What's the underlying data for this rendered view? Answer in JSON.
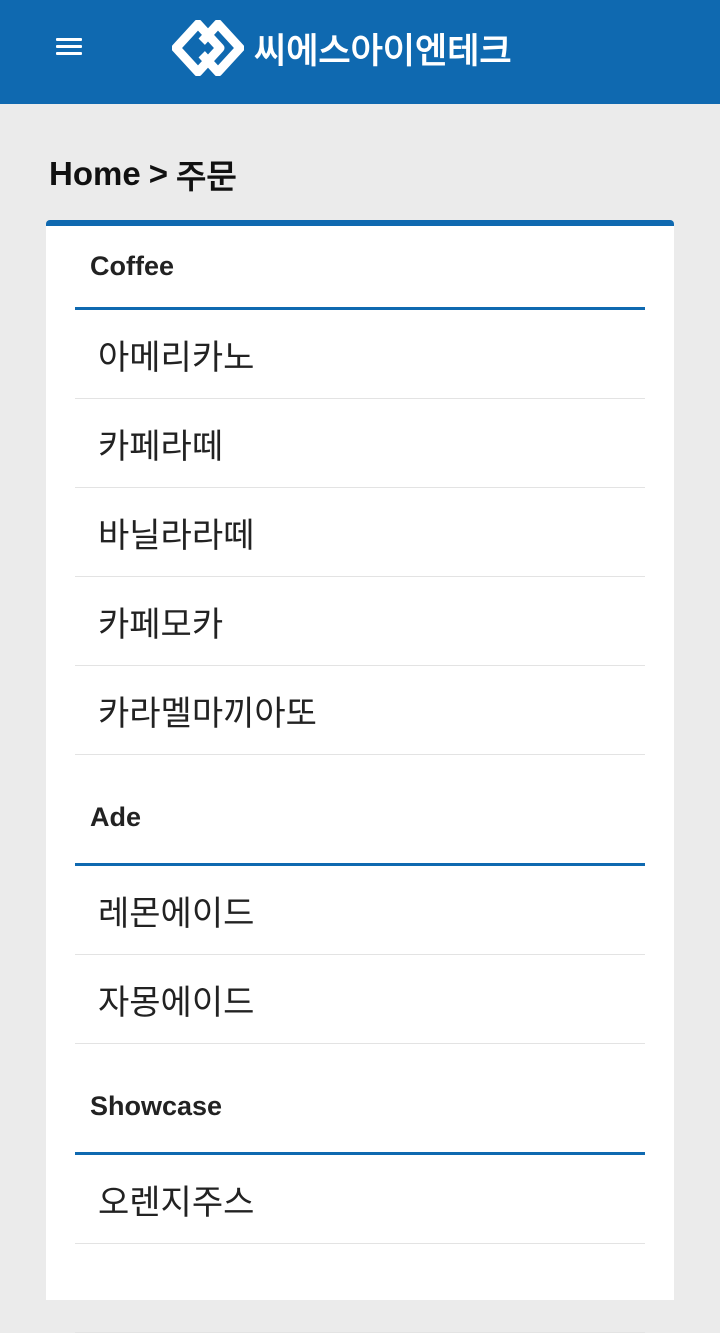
{
  "header": {
    "brand": "씨에스아이엔테크",
    "menu_icon": "hamburger-menu-icon",
    "logo_icon": "linked-diamonds-logo"
  },
  "breadcrumb": {
    "home": "Home",
    "separator": ">",
    "current": "주문"
  },
  "colors": {
    "primary": "#0f69b0",
    "background": "#ebebeb"
  },
  "menu": {
    "sections": [
      {
        "title": "Coffee",
        "items": [
          "아메리카노",
          "카페라떼",
          "바닐라라떼",
          "카페모카",
          "카라멜마끼아또"
        ]
      },
      {
        "title": "Ade",
        "items": [
          "레몬에이드",
          "자몽에이드"
        ]
      },
      {
        "title": "Showcase",
        "items": [
          "오렌지주스",
          ""
        ]
      }
    ]
  }
}
